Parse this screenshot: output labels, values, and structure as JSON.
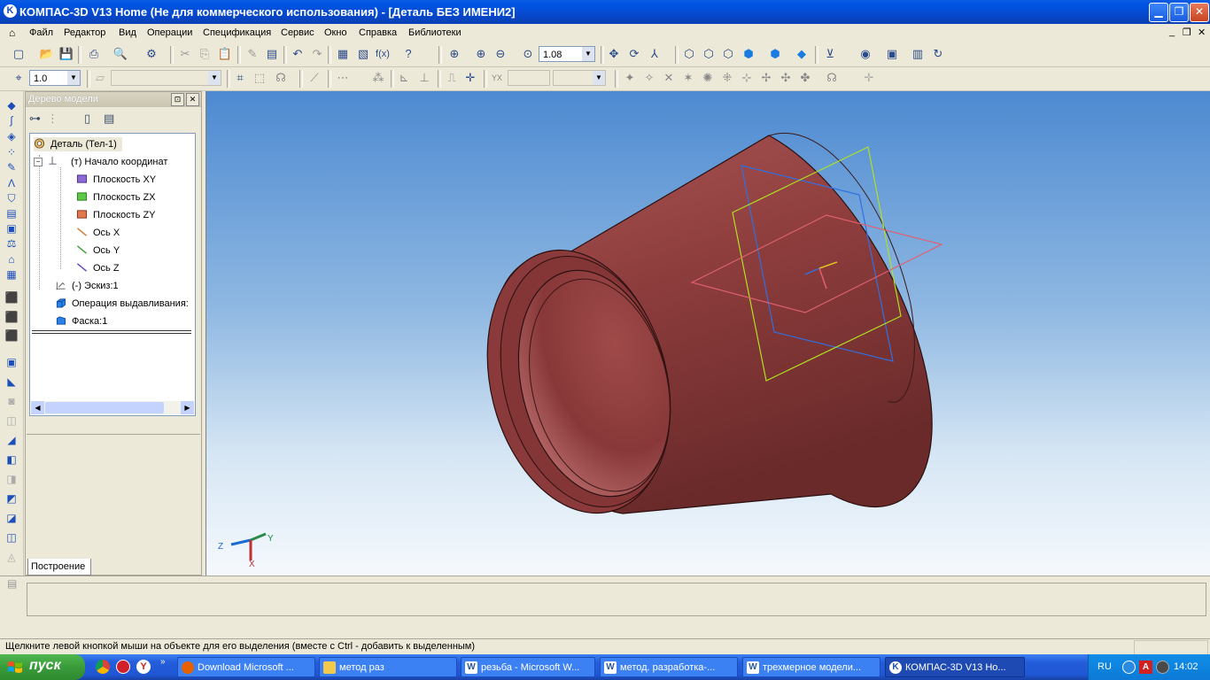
{
  "window": {
    "title": "КОМПАС-3D V13 Home (Не для коммерческого использования) - [Деталь БЕЗ ИМЕНИ2]"
  },
  "menu": {
    "items": [
      "Файл",
      "Редактор",
      "Вид",
      "Операции",
      "Спецификация",
      "Сервис",
      "Окно",
      "Справка",
      "Библиотеки"
    ]
  },
  "toolbar": {
    "zoom_value": "1.08",
    "step_value": "1.0"
  },
  "tree_panel": {
    "title": "Дерево модели",
    "tab_label": "Построение",
    "nodes": [
      {
        "label": "Деталь (Тел-1)",
        "icon": "part-icon"
      },
      {
        "label": "(т) Начало координат",
        "icon": "origin-icon"
      },
      {
        "label": "Плоскость XY",
        "icon": "plane-xy-icon"
      },
      {
        "label": "Плоскость ZX",
        "icon": "plane-zx-icon"
      },
      {
        "label": "Плоскость ZY",
        "icon": "plane-zy-icon"
      },
      {
        "label": "Ось X",
        "icon": "axis-x-icon"
      },
      {
        "label": "Ось Y",
        "icon": "axis-y-icon"
      },
      {
        "label": "Ось Z",
        "icon": "axis-z-icon"
      },
      {
        "label": "(-)  Эскиз:1",
        "icon": "sketch-icon"
      },
      {
        "label": "Операция выдавливания:",
        "icon": "extrude-icon"
      },
      {
        "label": "Фаска:1",
        "icon": "chamfer-icon"
      }
    ]
  },
  "viewport": {
    "axis_labels": {
      "x": "X",
      "y": "Y",
      "z": "Z"
    },
    "colors": {
      "part_body": "#8b3a3a",
      "plane_xy": "#e06070",
      "plane_zx": "#b0e020",
      "plane_zy": "#3070e0"
    }
  },
  "status": {
    "message": "Щелкните левой кнопкой мыши на объекте для его выделения (вместе с Ctrl - добавить к выделенным)"
  },
  "taskbar": {
    "start_label": "пуск",
    "tasks": [
      {
        "label": "Download Microsoft ...",
        "icon": "firefox-icon",
        "color": "#e66000"
      },
      {
        "label": "метод раз",
        "icon": "folder-icon",
        "color": "#f2c94c"
      },
      {
        "label": "резьба - Microsoft W...",
        "icon": "word-icon",
        "color": "#2b5797"
      },
      {
        "label": "метод. разработка-...",
        "icon": "word-icon",
        "color": "#2b5797"
      },
      {
        "label": "трехмерное модели...",
        "icon": "word-icon",
        "color": "#2b5797"
      },
      {
        "label": "КОМПАС-3D V13 Ho...",
        "icon": "kompas-icon",
        "color": "#1c4fb8"
      }
    ],
    "language": "RU",
    "clock": "14:02"
  }
}
